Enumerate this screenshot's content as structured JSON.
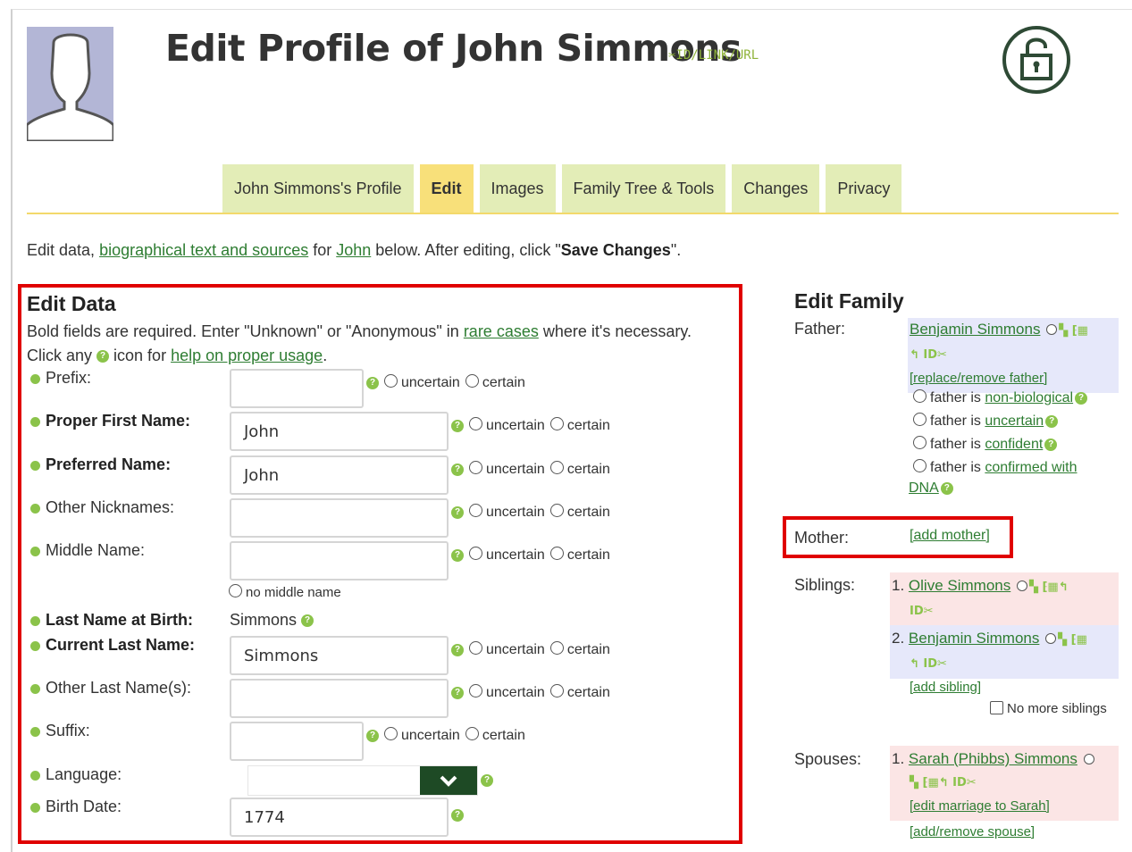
{
  "header": {
    "title": "Edit Profile of John Simmons",
    "id_link": "✂ID/LINK/URL"
  },
  "tabs": [
    {
      "label": "John Simmons's Profile",
      "active": false
    },
    {
      "label": "Edit",
      "active": true
    },
    {
      "label": "Images",
      "active": false
    },
    {
      "label": "Family Tree & Tools",
      "active": false
    },
    {
      "label": "Changes",
      "active": false
    },
    {
      "label": "Privacy",
      "active": false
    }
  ],
  "intro": {
    "prefix": "Edit data, ",
    "link1": "biographical text and sources",
    "middle": " for ",
    "link2": "John",
    "suffix": " below. After editing, click \"",
    "save": "Save Changes",
    "end": "\"."
  },
  "edit_data": {
    "title": "Edit Data",
    "note1_a": "Bold fields are required. Enter \"Unknown\" or \"Anonymous\" in ",
    "note1_link": "rare cases",
    "note1_b": " where it's necessary.",
    "note2_a": "Click any ",
    "note2_b": " icon for ",
    "note2_link": "help on proper usage",
    "note2_c": ".",
    "uncertain": "uncertain",
    "certain": "certain",
    "fields": {
      "prefix": {
        "label": "Prefix:",
        "value": ""
      },
      "first_name": {
        "label": "Proper First Name:",
        "value": "John"
      },
      "preferred_name": {
        "label": "Preferred Name:",
        "value": "John"
      },
      "nicknames": {
        "label": "Other Nicknames:",
        "value": ""
      },
      "middle_name": {
        "label": "Middle Name:",
        "value": "",
        "no_middle": "no middle name"
      },
      "lnab": {
        "label": "Last Name at Birth:",
        "value": "Simmons"
      },
      "current_last": {
        "label": "Current Last Name:",
        "value": "Simmons"
      },
      "other_last": {
        "label": "Other Last Name(s):",
        "value": ""
      },
      "suffix": {
        "label": "Suffix:",
        "value": ""
      },
      "language": {
        "label": "Language:",
        "value": ""
      },
      "birth_date": {
        "label": "Birth Date:",
        "value": "1774"
      }
    }
  },
  "family": {
    "title": "Edit Family",
    "father_label": "Father:",
    "father_name": "Benjamin Simmons",
    "father_id": "ID✂",
    "replace_father": "[replace/remove father]",
    "father_is": "father is ",
    "father_opts": [
      "non-biological",
      "uncertain",
      "confident",
      "confirmed with",
      "DNA"
    ],
    "mother_label": "Mother:",
    "add_mother": "[add mother]",
    "siblings_label": "Siblings:",
    "siblings": [
      {
        "num": "1.",
        "name": "Olive Simmons",
        "id": "ID✂"
      },
      {
        "num": "2.",
        "name": "Benjamin Simmons",
        "id": "ID✂"
      }
    ],
    "add_sibling": "[add sibling]",
    "no_more_siblings": "No more siblings",
    "spouses_label": "Spouses:",
    "spouse": {
      "num": "1.",
      "name": "Sarah (Phibbs) Simmons",
      "id": "ID✂"
    },
    "edit_marriage": "[edit marriage to Sarah]",
    "add_spouse": "[add/remove spouse]"
  },
  "colors": {
    "accent_green": "#8bc34a",
    "tab_bg": "#e3edb7",
    "tab_active": "#f8e07a",
    "highlight_red": "#e00000"
  },
  "icons": [
    "lock-icon",
    "avatar-silhouette",
    "help-icon",
    "chevron-down-icon",
    "scissors-icon"
  ]
}
